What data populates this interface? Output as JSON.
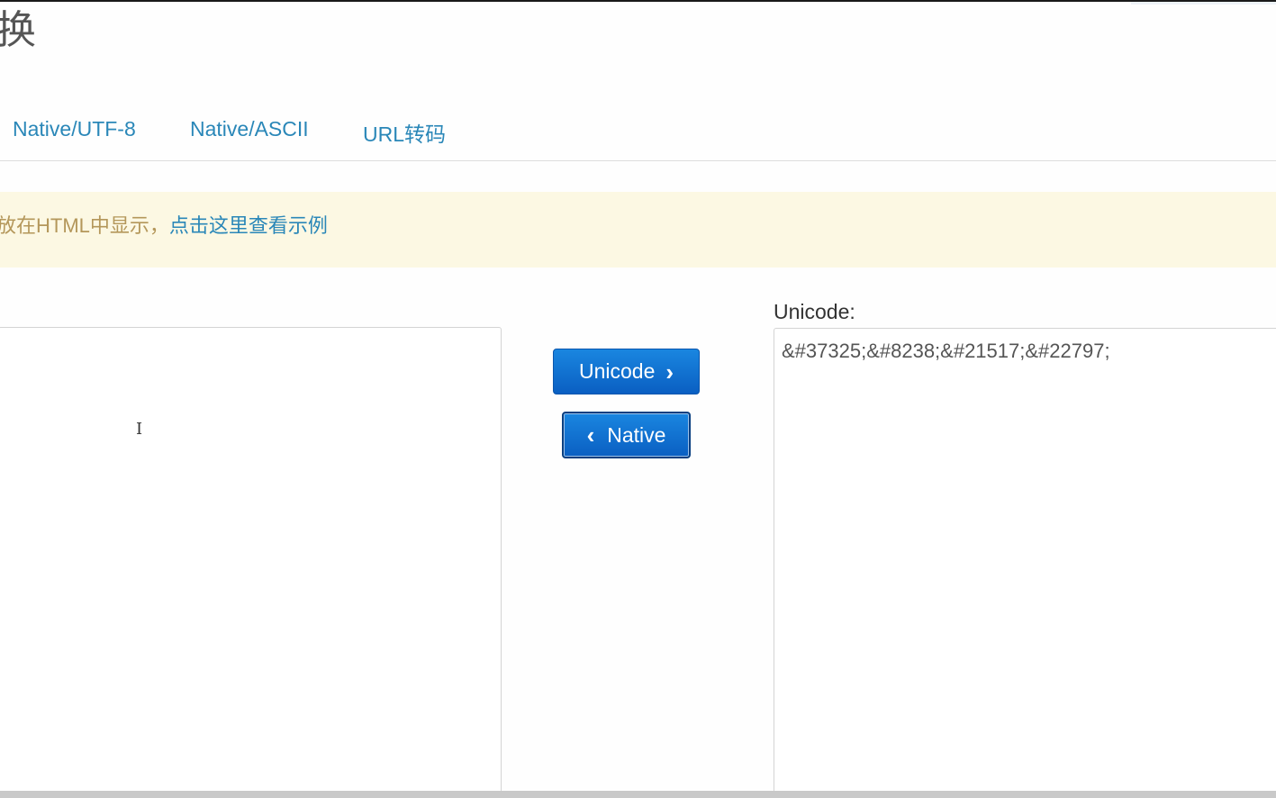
{
  "page": {
    "title": "换"
  },
  "nav": {
    "tabs": [
      {
        "label": "Native/UTF-8"
      },
      {
        "label": "Native/ASCII"
      },
      {
        "label": "URL转码"
      }
    ]
  },
  "alert": {
    "text": "放在HTML中显示，",
    "link_text": "点击这里查看示例"
  },
  "converter": {
    "native_input": {
      "value": ""
    },
    "to_unicode_button_label": "Unicode",
    "to_native_button_label": "Native",
    "unicode_label": "Unicode:",
    "unicode_output": {
      "value": "&#37325;&#8238;&#21517;&#22797;"
    }
  },
  "colors": {
    "link": "#2a87b8",
    "alert_bg": "#fcf8e3",
    "alert_text": "#b4975a",
    "button_blue": "#0a6fd0"
  },
  "icons": {
    "right": "chevron-right-icon",
    "left": "chevron-left-icon",
    "cursor": "text-cursor-icon"
  }
}
